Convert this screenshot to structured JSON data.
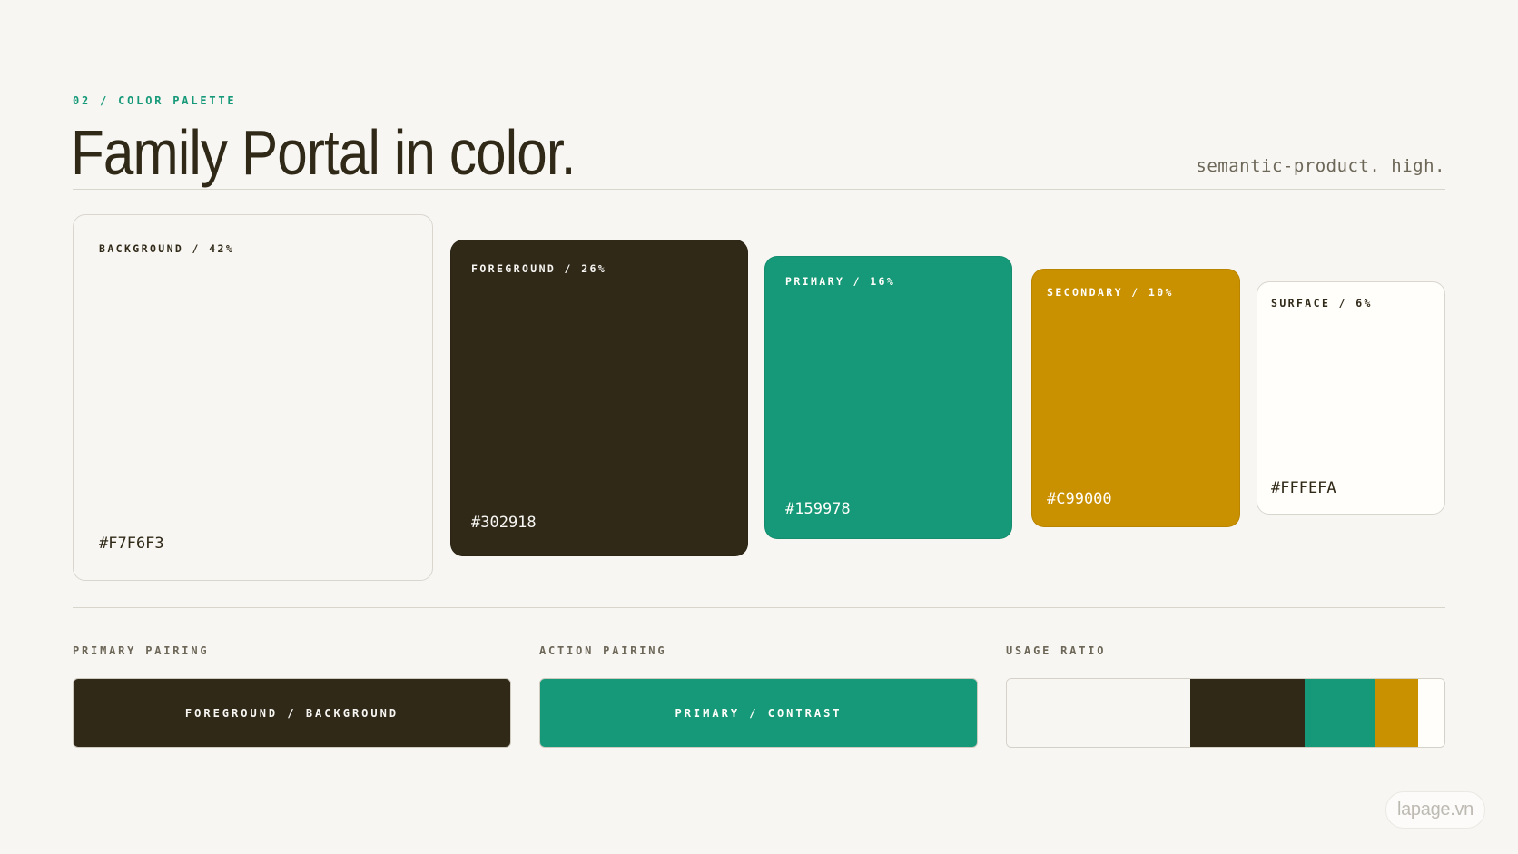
{
  "header": {
    "eyebrow": "02 / COLOR PALETTE",
    "title": "Family Portal in color.",
    "subtitle": "semantic-product. high."
  },
  "swatches": [
    {
      "label": "BACKGROUND / 42%",
      "hex": "#F7F6F3",
      "color": "#F7F6F3",
      "text_color": "#302918"
    },
    {
      "label": "FOREGROUND / 26%",
      "hex": "#302918",
      "color": "#302918",
      "text_color": "#F7F6F3"
    },
    {
      "label": "PRIMARY / 16%",
      "hex": "#159978",
      "color": "#159978",
      "text_color": "#FFFEFA"
    },
    {
      "label": "SECONDARY / 10%",
      "hex": "#C99000",
      "color": "#C99000",
      "text_color": "#FFFEFA"
    },
    {
      "label": "SURFACE / 6%",
      "hex": "#FFFEFA",
      "color": "#FFFEFA",
      "text_color": "#302918"
    }
  ],
  "pairings": {
    "primary": {
      "section_label": "PRIMARY PAIRING",
      "text": "FOREGROUND / BACKGROUND",
      "bg": "#302918",
      "fg": "#F7F6F3"
    },
    "action": {
      "section_label": "ACTION PAIRING",
      "text": "PRIMARY / CONTRAST",
      "bg": "#159978",
      "fg": "#FFFEFA"
    }
  },
  "usage_ratio": {
    "section_label": "USAGE RATIO",
    "segments": [
      {
        "name": "background",
        "percent": 42,
        "color": "#F7F6F3"
      },
      {
        "name": "foreground",
        "percent": 26,
        "color": "#302918"
      },
      {
        "name": "primary",
        "percent": 16,
        "color": "#159978"
      },
      {
        "name": "secondary",
        "percent": 10,
        "color": "#C99000"
      },
      {
        "name": "surface",
        "percent": 6,
        "color": "#FFFEFA"
      }
    ]
  },
  "watermark": "lapage.vn"
}
